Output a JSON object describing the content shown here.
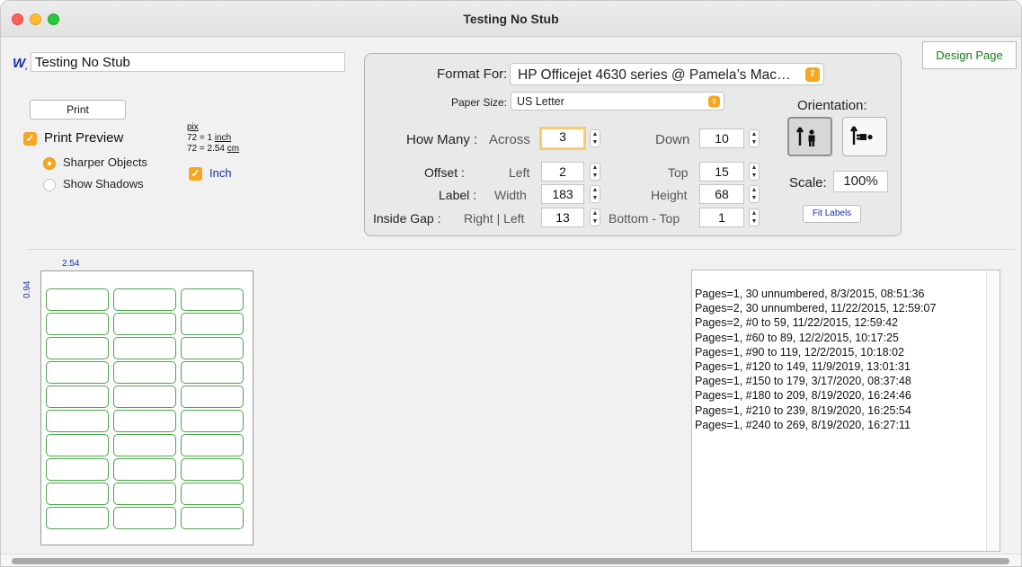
{
  "window": {
    "title": "Testing No Stub"
  },
  "doc": {
    "name": "Testing No Stub",
    "icon": "w-app-icon"
  },
  "buttons": {
    "print": "Print",
    "design_page": "Design Page",
    "fit_labels": "Fit Labels"
  },
  "preview": {
    "print_preview_label": "Print Preview",
    "print_preview_checked": true,
    "options": [
      {
        "label": "Sharper Objects",
        "selected": true
      },
      {
        "label": "Show Shadows",
        "selected": false
      }
    ]
  },
  "units": {
    "pix": "pix",
    "inch_eq_prefix": "72 = 1 ",
    "inch_word": "inch",
    "cm_eq_prefix": "72 = 2.54 ",
    "cm_word": "cm",
    "inch_checkbox_label": "Inch",
    "inch_checked": true
  },
  "format": {
    "format_for_label": "Format For:",
    "printer": "HP Officejet 4630 series @ Pamela’s Mac…",
    "paper_size_label": "Paper Size:",
    "paper_size": "US Letter",
    "how_many_label": "How Many :",
    "across_label": "Across",
    "across": "3",
    "down_label": "Down",
    "down": "10",
    "offset_label": "Offset :",
    "left_label": "Left",
    "left": "2",
    "top_label": "Top",
    "top": "15",
    "label_label": "Label :",
    "width_label": "Width",
    "width": "183",
    "height_label": "Height",
    "height": "68",
    "inside_gap_label": "Inside Gap :",
    "right_left_label": "Right | Left",
    "right_left": "13",
    "bottom_top_label": "Bottom - Top",
    "bottom_top": "1",
    "orientation_label": "Orientation:",
    "orientation_selected": "portrait",
    "scale_label": "Scale:",
    "scale": "100%"
  },
  "sheet": {
    "width_dim": "2.54",
    "height_dim": "0.94",
    "columns": 3,
    "rows": 10
  },
  "history": [
    "Pages=1, 30 unnumbered, 8/3/2015, 08:51:36",
    "Pages=2, 30 unnumbered, 11/22/2015, 12:59:07",
    "Pages=2, #0 to 59, 11/22/2015, 12:59:42",
    "Pages=1, #60 to 89, 12/2/2015, 10:17:25",
    "Pages=1, #90 to 119, 12/2/2015, 10:18:02",
    "Pages=1, #120 to 149, 11/9/2019, 13:01:31",
    "Pages=1, #150 to 179, 3/17/2020, 08:37:48",
    "Pages=1, #180 to 209, 8/19/2020, 16:24:46",
    "Pages=1, #210 to 239, 8/19/2020, 16:25:54",
    "Pages=1, #240 to 269, 8/19/2020, 16:27:11"
  ],
  "colors": {
    "accent": "#f5a623",
    "link_blue": "#1b2fa8",
    "label_green": "#4ca54c",
    "design_green": "#197a1a"
  }
}
